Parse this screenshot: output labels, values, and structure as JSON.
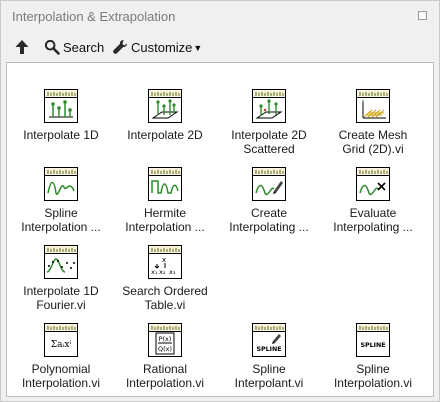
{
  "window": {
    "title": "Interpolation & Extrapolation"
  },
  "toolbar": {
    "search_label": "Search",
    "customize_label": "Customize"
  },
  "items": [
    {
      "label": "Interpolate 1D",
      "icon": "interpolate-1d-icon"
    },
    {
      "label": "Interpolate 2D",
      "icon": "interpolate-2d-icon"
    },
    {
      "label": "Interpolate 2D\nScattered",
      "icon": "interpolate-2d-scattered-icon"
    },
    {
      "label": "Create Mesh\nGrid (2D).vi",
      "icon": "mesh-grid-icon"
    },
    {
      "label": "Spline\nInterpolation ...",
      "icon": "spline-interpolation-icon"
    },
    {
      "label": "Hermite\nInterpolation ...",
      "icon": "hermite-interpolation-icon"
    },
    {
      "label": "Create\nInterpolating ...",
      "icon": "create-interpolating-icon"
    },
    {
      "label": "Evaluate\nInterpolating ...",
      "icon": "evaluate-interpolating-icon"
    },
    {
      "label": "Interpolate 1D\nFourier.vi",
      "icon": "fourier-icon"
    },
    {
      "label": "Search Ordered\nTable.vi",
      "icon": "search-table-icon"
    },
    {
      "label": "Polynomial\nInterpolation.vi",
      "icon": "polynomial-icon",
      "icon_text": "Σaᵢxⁱ"
    },
    {
      "label": "Rational\nInterpolation.vi",
      "icon": "rational-icon",
      "icon_text": [
        "P(x)",
        "Q(x)"
      ]
    },
    {
      "label": "Spline\nInterpolant.vi",
      "icon": "spline-interpolant-icon",
      "icon_text": "SPLINE"
    },
    {
      "label": "Spline\nInterpolation.vi",
      "icon": "spline-interpolation-vi-icon",
      "icon_text": "SPLINE"
    }
  ]
}
